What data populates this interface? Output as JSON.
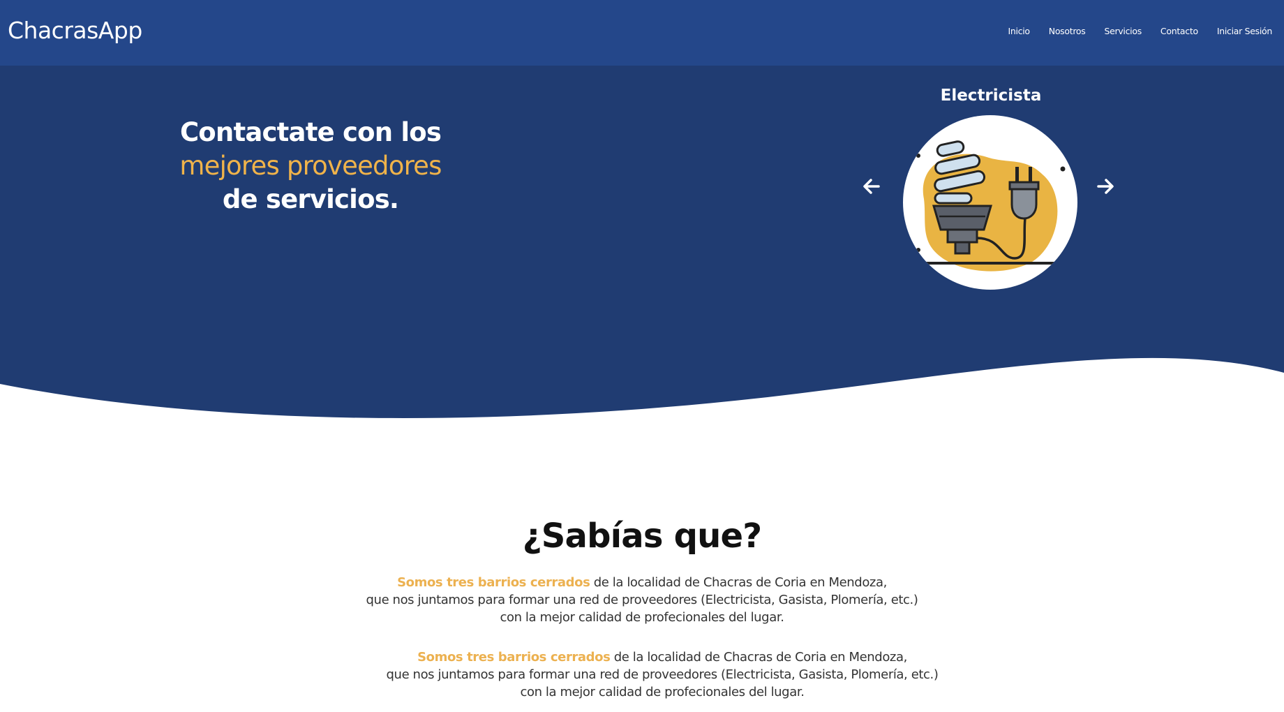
{
  "navbar": {
    "brand": "ChacrasApp",
    "links": [
      "Inicio",
      "Nosotros",
      "Servicios",
      "Contacto",
      "Iniciar Sesión"
    ]
  },
  "hero": {
    "line1": "Contactate con los",
    "line2": "mejores proveedores",
    "line3": "de servicios.",
    "carousel": {
      "title": "Electricista",
      "prev_icon": "arrow-left-icon",
      "next_icon": "arrow-right-icon",
      "image_icon": "bulb-and-plug-icon"
    }
  },
  "about": {
    "title": "¿Sabías que?",
    "paragraphs": [
      {
        "highlight": "Somos tres barrios cerrados",
        "rest1": " de la localidad de Chacras de Coria en Mendoza,",
        "line2": "que nos juntamos para formar una red de proveedores (Electricista, Gasista, Plomería, etc.)",
        "line3": "con la mejor calidad de profecionales del lugar."
      },
      {
        "highlight": "Somos tres barrios cerrados",
        "rest1": " de la localidad de Chacras de Coria en Mendoza,",
        "line2": "que nos juntamos para formar una red de proveedores (Electricista, Gasista, Plomería, etc.)",
        "line3": "con la mejor calidad de profecionales del lugar."
      }
    ]
  },
  "colors": {
    "navbar": "#24478a",
    "hero": "#203c72",
    "accent": "#f0b34a"
  }
}
